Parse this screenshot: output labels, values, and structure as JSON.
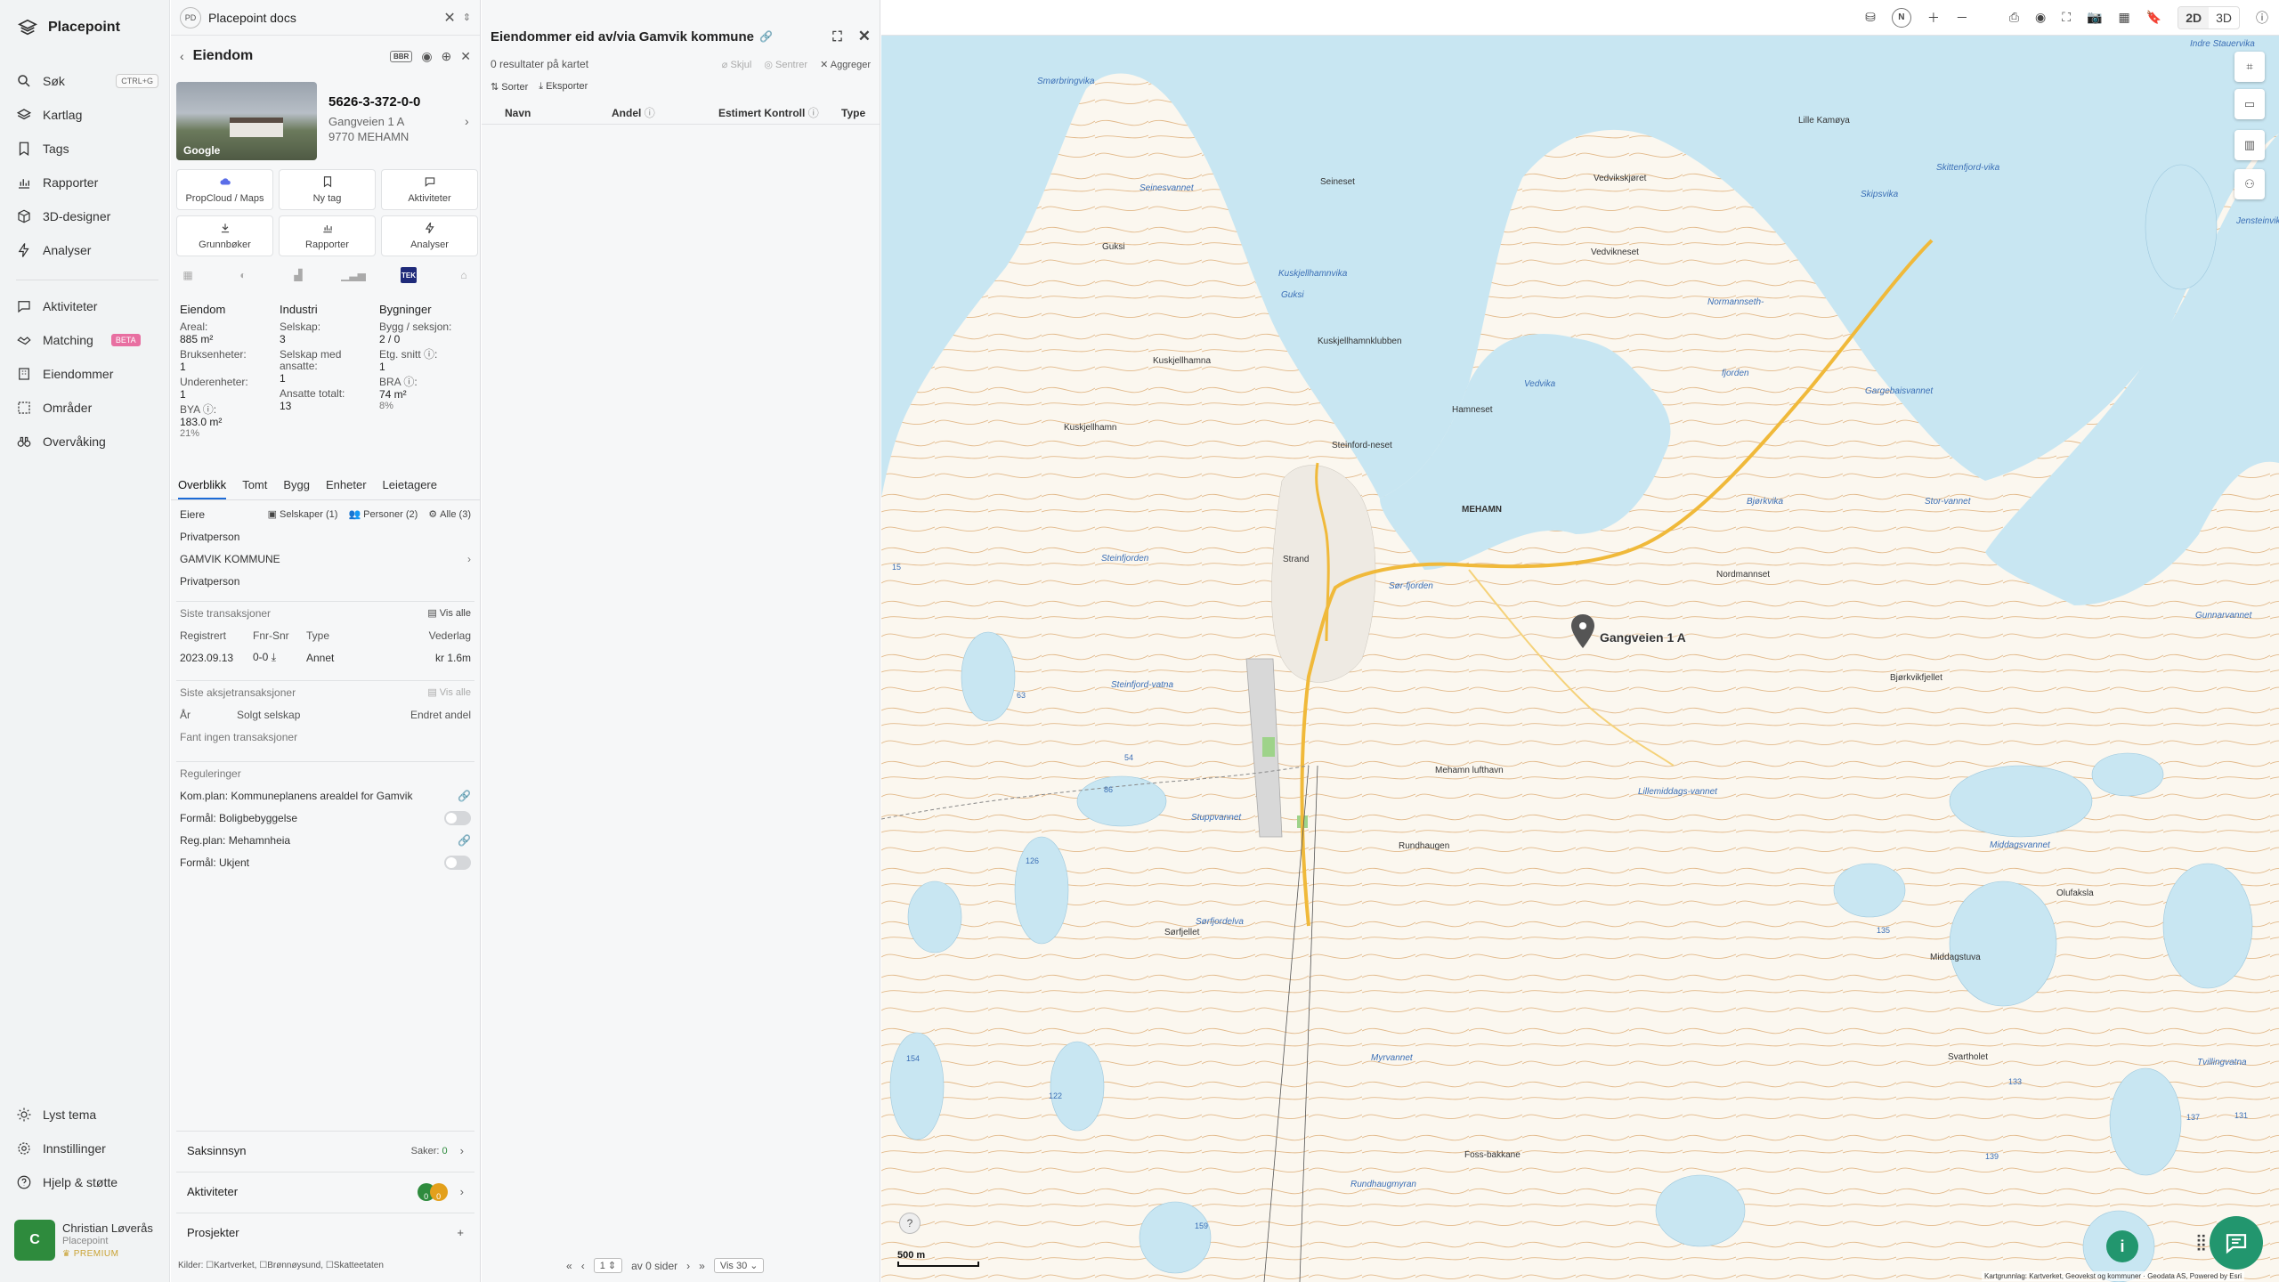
{
  "nav": {
    "brand": "Placepoint",
    "items": [
      {
        "label": "Søk",
        "shortcut": "CTRL+G",
        "icon": "search-icon"
      },
      {
        "label": "Kartlag",
        "icon": "layers-icon"
      },
      {
        "label": "Tags",
        "icon": "bookmark-icon"
      },
      {
        "label": "Rapporter",
        "icon": "chart-icon"
      },
      {
        "label": "3D-designer",
        "icon": "cube-icon"
      },
      {
        "label": "Analyser",
        "icon": "bolt-icon"
      }
    ],
    "items2": [
      {
        "label": "Aktiviteter",
        "icon": "chat-icon"
      },
      {
        "label": "Matching",
        "badge": "BETA",
        "icon": "handshake-icon"
      },
      {
        "label": "Eiendommer",
        "icon": "building-icon"
      },
      {
        "label": "Områder",
        "icon": "area-icon"
      },
      {
        "label": "Overvåking",
        "icon": "binoculars-icon"
      }
    ],
    "bottom": [
      {
        "label": "Lyst tema",
        "icon": "sun-icon"
      },
      {
        "label": "Innstillinger",
        "icon": "gear-icon"
      },
      {
        "label": "Hjelp & støtte",
        "icon": "help-icon"
      }
    ],
    "user": {
      "initial": "C",
      "name": "Christian Løverås",
      "org": "Placepoint",
      "plan": "PREMIUM"
    }
  },
  "docbar": {
    "badge": "PD",
    "title": "Placepoint docs"
  },
  "property": {
    "header": "Eiendom",
    "bbr": "BBR",
    "photo_label": "Google",
    "id": "5626-3-372-0-0",
    "address": "Gangveien 1 A",
    "zip": "9770 MEHAMN",
    "tiles": [
      {
        "label": "PropCloud / Maps",
        "icon": "cloud-icon"
      },
      {
        "label": "Ny tag",
        "icon": "bookmark-icon"
      },
      {
        "label": "Aktiviteter",
        "icon": "chat-icon"
      },
      {
        "label": "Grunnbøker",
        "icon": "download-icon"
      },
      {
        "label": "Rapporter",
        "icon": "chart-icon"
      },
      {
        "label": "Analyser",
        "icon": "bolt-icon"
      }
    ],
    "source_tek": "TEK",
    "facts": {
      "eiendom": {
        "title": "Eiendom",
        "areal_lbl": "Areal:",
        "areal": "885 m²",
        "bruks_lbl": "Bruksenheter:",
        "bruks": "1",
        "under_lbl": "Underenheter:",
        "under": "1",
        "bya_lbl": "BYA ⓘ:",
        "bya": "183.0 m²",
        "bya_pct": "21%"
      },
      "industri": {
        "title": "Industri",
        "selskap_lbl": "Selskap:",
        "selskap": "3",
        "ansatte_lbl": "Selskap med ansatte:",
        "ansatte": "1",
        "ansatte_tot_lbl": "Ansatte totalt:",
        "ansatte_tot": "13"
      },
      "bygninger": {
        "title": "Bygninger",
        "bygg_lbl": "Bygg / seksjon:",
        "bygg": "2 / 0",
        "etg_lbl": "Etg. snitt ⓘ:",
        "etg": "1",
        "bra_lbl": "BRA ⓘ:",
        "bra": "74 m²",
        "bra_pct": "8%"
      }
    },
    "tabs": [
      "Overblikk",
      "Tomt",
      "Bygg",
      "Enheter",
      "Leietagere"
    ],
    "owners": {
      "title": "Eiere",
      "chip_selskaper": "Selskaper (1)",
      "chip_personer": "Personer (2)",
      "chip_alle": "Alle (3)",
      "list": [
        "Privatperson",
        "GAMVIK KOMMUNE",
        "Privatperson"
      ]
    },
    "transactions": {
      "title": "Siste transaksjoner",
      "vis_alle": "Vis alle",
      "headers": [
        "Registrert",
        "Fnr-Snr",
        "Type",
        "Vederlag"
      ],
      "row": {
        "date": "2023.09.13",
        "fnr": "0-0",
        "type": "Annet",
        "price": "kr 1.6m"
      }
    },
    "shares": {
      "title": "Siste aksjetransaksjoner",
      "vis_alle": "Vis alle",
      "headers": [
        "År",
        "Solgt selskap",
        "Endret andel"
      ],
      "empty": "Fant ingen transaksjoner"
    },
    "regs": {
      "title": "Reguleringer",
      "items": [
        "Kom.plan: Kommuneplanens arealdel for Gamvik",
        "Formål: Boligbebyggelse",
        "Reg.plan: Mehamnheia",
        "Formål: Ukjent"
      ]
    },
    "saksinnsyn": {
      "label": "Saksinnsyn",
      "count_lbl": "Saker:",
      "count": "0"
    },
    "aktiviteter": {
      "label": "Aktiviteter",
      "avatar_a": "0",
      "avatar_b": "0"
    },
    "prosjekter": {
      "label": "Prosjekter",
      "action": "+"
    },
    "kilder": {
      "label": "Kilder:",
      "items": [
        "Kartverket,",
        "Brønnøysund,",
        "Skatteetaten"
      ]
    }
  },
  "results": {
    "title": "Eiendommer eid av/via Gamvik kommune",
    "count_text": "0 resultater på kartet",
    "skjul": "Skjul",
    "sentrer": "Sentrer",
    "aggreger": "Aggreger",
    "sorter": "Sorter",
    "eksporter": "Eksporter",
    "columns": [
      "Navn",
      "Andel",
      "Estimert Kontroll",
      "Type"
    ],
    "pager": {
      "page": "1",
      "of_pages": "av 0 sider",
      "per_page": "Vis 30"
    }
  },
  "map": {
    "mode_2d": "2D",
    "mode_3d": "3D",
    "north": "N",
    "pin_label": "Gangveien 1 A",
    "scale": "500 m",
    "help": "?",
    "info": "i",
    "credit": "Kartgrunnlag: Kartverket, Geovekst og kommuner · Geodata AS, Powered by Esri",
    "places": [
      {
        "name": "Indre Stauervika",
        "italic": true
      },
      {
        "name": "Smørbringvika",
        "italic": true
      },
      {
        "name": "Lille Kamøya",
        "italic": false
      },
      {
        "name": "Seinesvannet",
        "italic": true
      },
      {
        "name": "Seineset",
        "italic": false
      },
      {
        "name": "Vedvikskjøret",
        "italic": false
      },
      {
        "name": "Skipsvika",
        "italic": true
      },
      {
        "name": "Skittenfjord-vika",
        "italic": true
      },
      {
        "name": "Jensteinvika",
        "italic": true
      },
      {
        "name": "Guksi",
        "italic": false
      },
      {
        "name": "Kuskjellhamnvika",
        "italic": true
      },
      {
        "name": "Guksi",
        "italic": true
      },
      {
        "name": "Vedvikneset",
        "italic": false
      },
      {
        "name": "Normannseth-",
        "italic": true
      },
      {
        "name": "Kuskjellhamnklubben",
        "italic": false
      },
      {
        "name": "Vedvika",
        "italic": true
      },
      {
        "name": "fjorden",
        "italic": true
      },
      {
        "name": "Kuskjellhamna",
        "italic": false
      },
      {
        "name": "Gargebaisvannet",
        "italic": true
      },
      {
        "name": "Hamneset",
        "italic": false
      },
      {
        "name": "Kuskjellhamn",
        "italic": false
      },
      {
        "name": "Steinford-neset",
        "italic": false
      },
      {
        "name": "MEHAMN",
        "italic": false
      },
      {
        "name": "Bjørkvika",
        "italic": true
      },
      {
        "name": "Stor-vannet",
        "italic": true
      },
      {
        "name": "Steinfjorden",
        "italic": true
      },
      {
        "name": "Strand",
        "italic": false
      },
      {
        "name": "Nordmannset",
        "italic": false
      },
      {
        "name": "Sør-fjorden",
        "italic": true
      },
      {
        "name": "Gunnarvannet",
        "italic": true
      },
      {
        "name": "Bjørkvikfjellet",
        "italic": false
      },
      {
        "name": "Steinfjord-vatna",
        "italic": true
      },
      {
        "name": "Lillemiddags-vannet",
        "italic": true
      },
      {
        "name": "Mehamn lufthavn",
        "italic": false
      },
      {
        "name": "Middagsvannet",
        "italic": true
      },
      {
        "name": "Stuppvannet",
        "italic": true
      },
      {
        "name": "Rundhaugen",
        "italic": false
      },
      {
        "name": "Sørfjellet",
        "italic": false
      },
      {
        "name": "Olufaksla",
        "italic": false
      },
      {
        "name": "Middagstuva",
        "italic": false
      },
      {
        "name": "Myrvannet",
        "italic": true
      },
      {
        "name": "Tvillingvatna",
        "italic": true
      },
      {
        "name": "Svartholet",
        "italic": false
      },
      {
        "name": "Foss-bakkane",
        "italic": false
      },
      {
        "name": "Rundhaugmyran",
        "italic": true
      },
      {
        "name": "Sørfjordelva",
        "italic": true
      }
    ],
    "heights": [
      "15",
      "63",
      "54",
      "86",
      "126",
      "154",
      "122",
      "159",
      "135",
      "133",
      "139",
      "137",
      "131"
    ]
  }
}
